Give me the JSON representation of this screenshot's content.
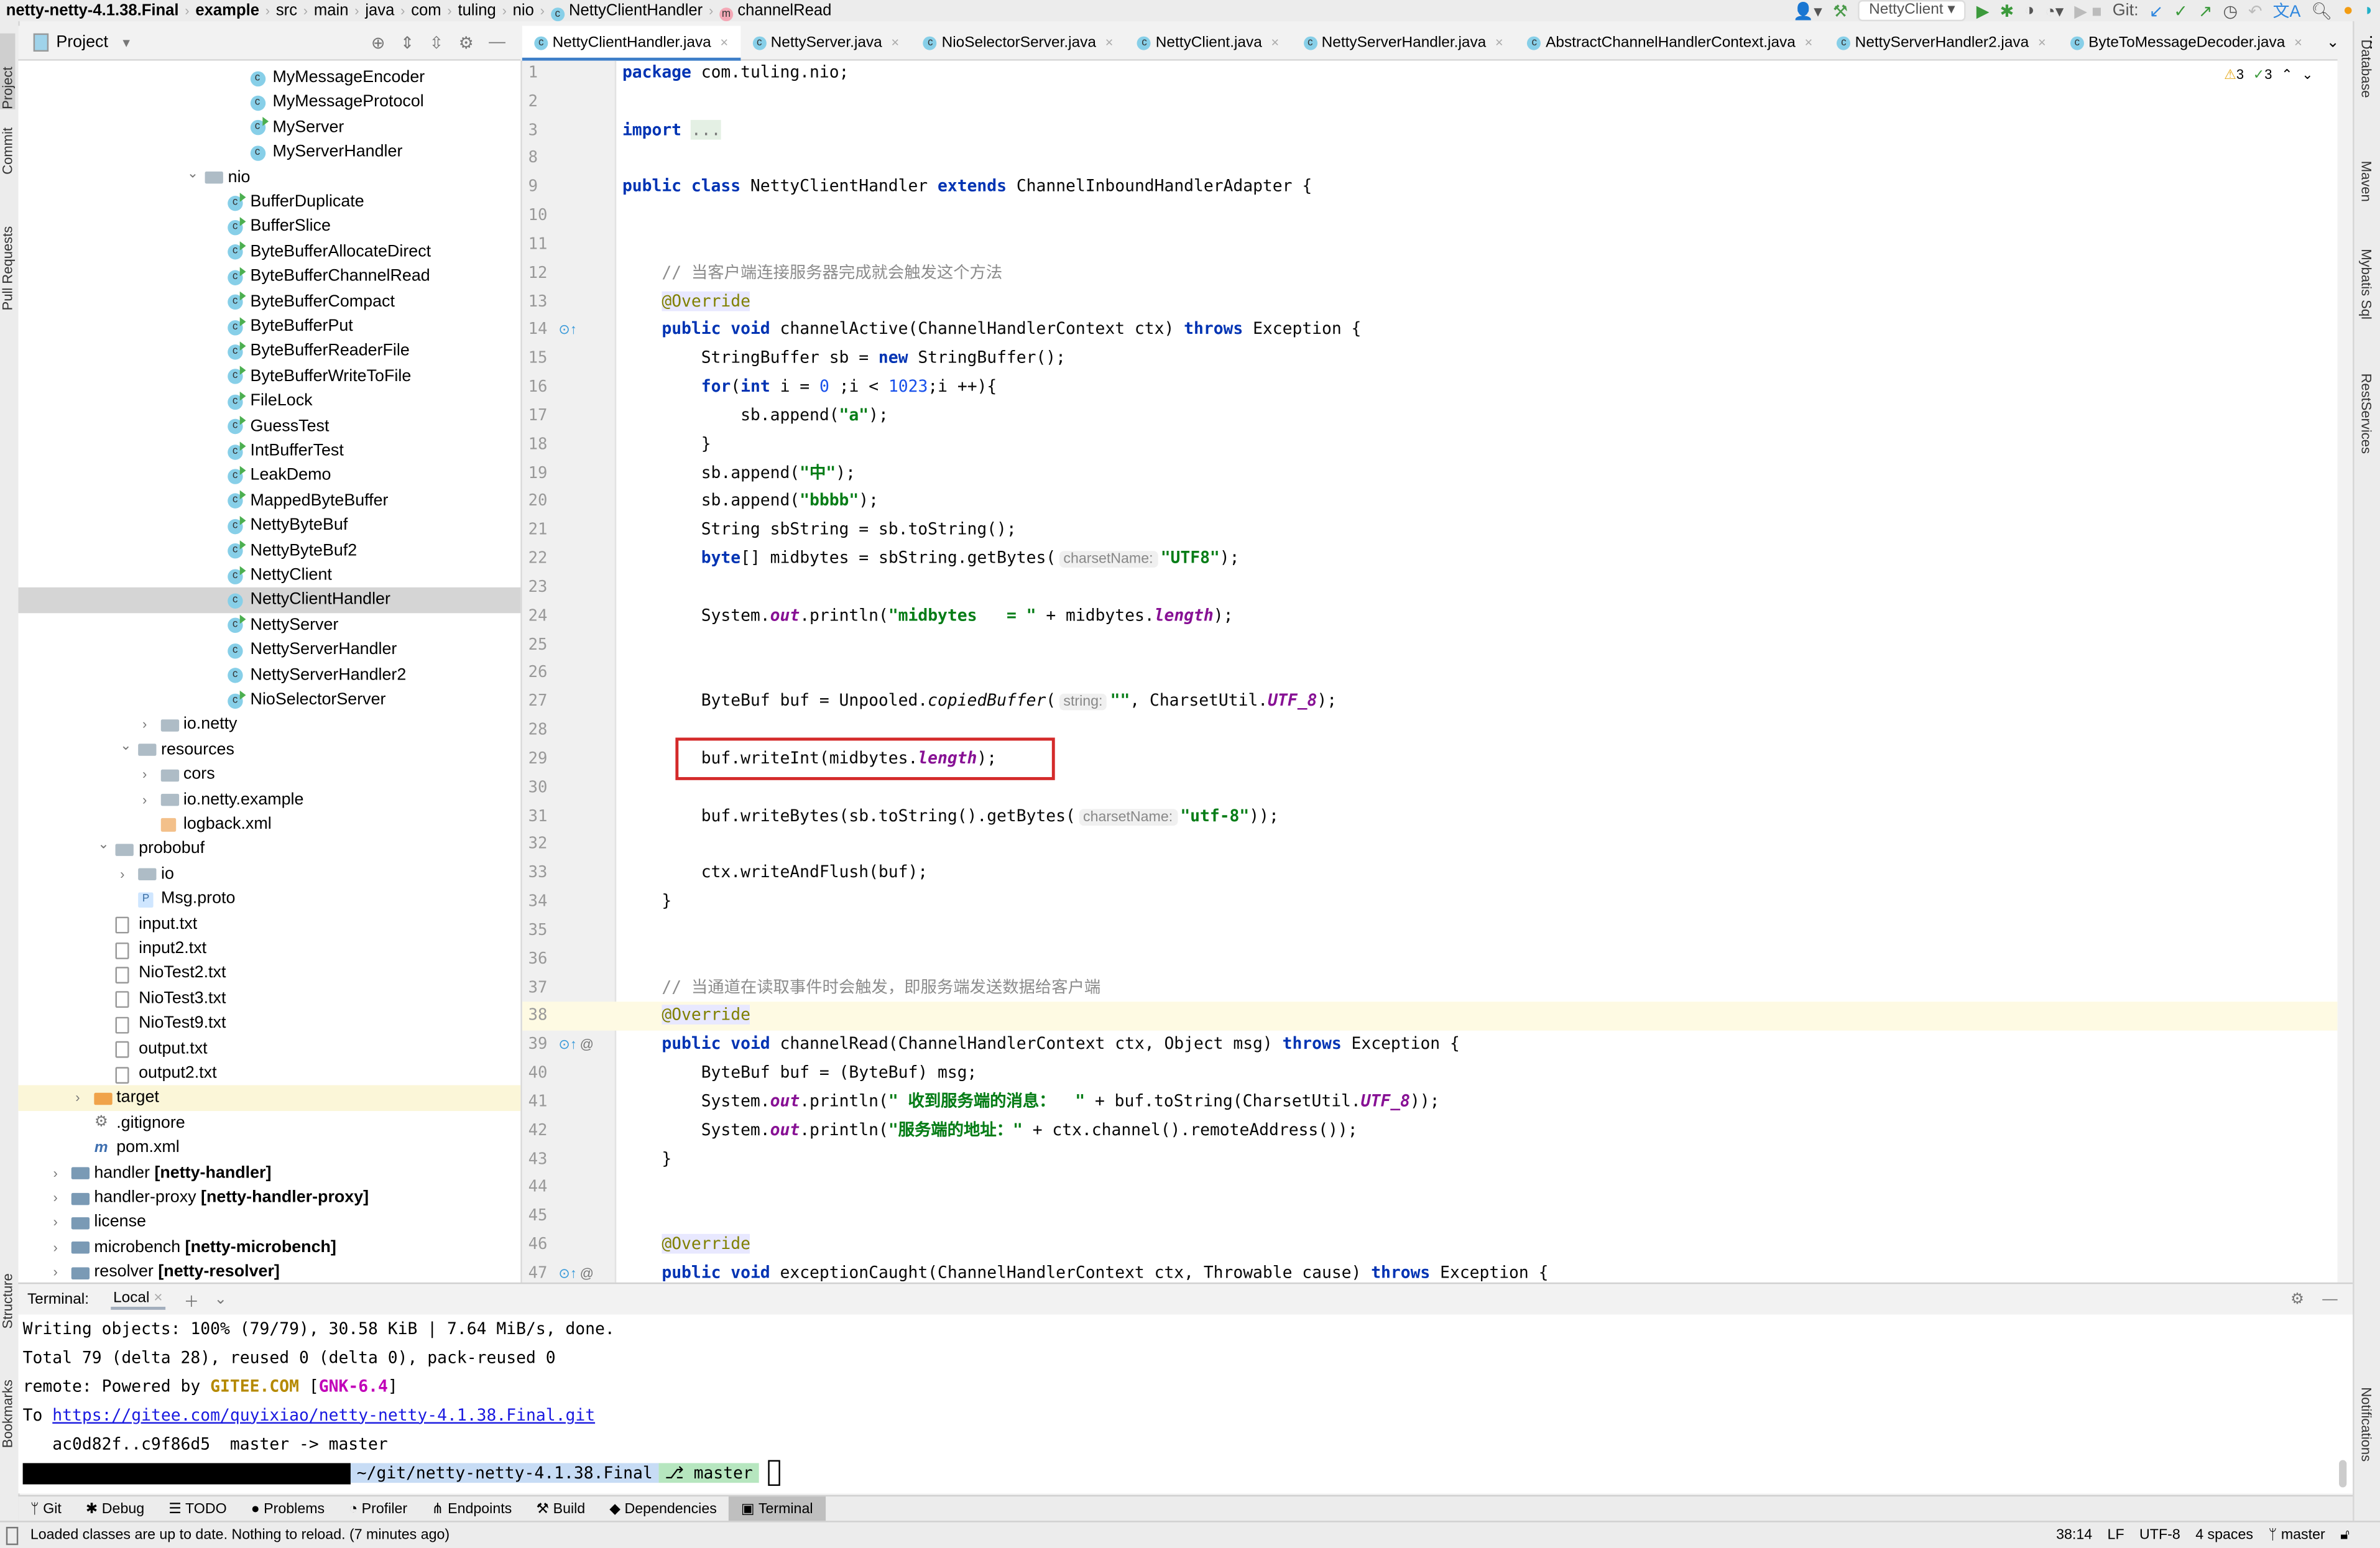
{
  "breadcrumb": [
    "netty-netty-4.1.38.Final",
    "example",
    "src",
    "main",
    "java",
    "com",
    "tuling",
    "nio",
    "NettyClientHandler",
    "channelRead"
  ],
  "toolbar": {
    "run_config": "NettyClient",
    "git_label": "Git:",
    "icons": [
      "user-icon",
      "hammer-icon",
      "run-icon",
      "debug-icon",
      "coverage-icon",
      "profile-icon",
      "stop-icon",
      "git-update-icon",
      "git-commit-icon",
      "git-push-icon",
      "history-icon",
      "rollback-icon",
      "translate-icon",
      "search-icon",
      "ide-update-icon",
      "jetbrains-logo-icon"
    ]
  },
  "left_strip": [
    "Project",
    "Commit",
    "Pull Requests",
    "Structure",
    "Bookmarks"
  ],
  "right_strip": [
    "Database",
    "Maven",
    "Mybatis Sql",
    "RestServices",
    "Notifications"
  ],
  "project_panel": {
    "title": "Project",
    "tree": [
      {
        "level": 8,
        "icon": "class",
        "label": "MyMessageEncoder"
      },
      {
        "level": 8,
        "icon": "class",
        "label": "MyMessageProtocol"
      },
      {
        "level": 8,
        "icon": "class-run",
        "label": "MyServer"
      },
      {
        "level": 8,
        "icon": "class",
        "label": "MyServerHandler"
      },
      {
        "level": 6,
        "icon": "folder",
        "label": "nio",
        "chevron": "open"
      },
      {
        "level": 7,
        "icon": "class-run",
        "label": "BufferDuplicate"
      },
      {
        "level": 7,
        "icon": "class-run",
        "label": "BufferSlice"
      },
      {
        "level": 7,
        "icon": "class-run",
        "label": "ByteBufferAllocateDirect"
      },
      {
        "level": 7,
        "icon": "class-run",
        "label": "ByteBufferChannelRead"
      },
      {
        "level": 7,
        "icon": "class-run",
        "label": "ByteBufferCompact"
      },
      {
        "level": 7,
        "icon": "class-run",
        "label": "ByteBufferPut"
      },
      {
        "level": 7,
        "icon": "class-run",
        "label": "ByteBufferReaderFile"
      },
      {
        "level": 7,
        "icon": "class-run",
        "label": "ByteBufferWriteToFile"
      },
      {
        "level": 7,
        "icon": "class-run",
        "label": "FileLock"
      },
      {
        "level": 7,
        "icon": "class-run",
        "label": "GuessTest"
      },
      {
        "level": 7,
        "icon": "class-run",
        "label": "IntBufferTest"
      },
      {
        "level": 7,
        "icon": "class-run",
        "label": "LeakDemo"
      },
      {
        "level": 7,
        "icon": "class-run",
        "label": "MappedByteBuffer"
      },
      {
        "level": 7,
        "icon": "class-run",
        "label": "NettyByteBuf"
      },
      {
        "level": 7,
        "icon": "class-run",
        "label": "NettyByteBuf2"
      },
      {
        "level": 7,
        "icon": "class-run",
        "label": "NettyClient"
      },
      {
        "level": 7,
        "icon": "class",
        "label": "NettyClientHandler",
        "selected": true
      },
      {
        "level": 7,
        "icon": "class-run",
        "label": "NettyServer"
      },
      {
        "level": 7,
        "icon": "class",
        "label": "NettyServerHandler"
      },
      {
        "level": 7,
        "icon": "class",
        "label": "NettyServerHandler2"
      },
      {
        "level": 7,
        "icon": "class-run",
        "label": "NioSelectorServer"
      },
      {
        "level": 4,
        "icon": "folder",
        "label": "io.netty",
        "chevron": "closed"
      },
      {
        "level": 3,
        "icon": "folder",
        "label": "resources",
        "chevron": "open"
      },
      {
        "level": 4,
        "icon": "folder",
        "label": "cors",
        "chevron": "closed"
      },
      {
        "level": 4,
        "icon": "folder",
        "label": "io.netty.example",
        "chevron": "closed"
      },
      {
        "level": 4,
        "icon": "xml",
        "label": "logback.xml"
      },
      {
        "level": 2,
        "icon": "folder",
        "label": "probobuf",
        "chevron": "open"
      },
      {
        "level": 3,
        "icon": "folder",
        "label": "io",
        "chevron": "closed"
      },
      {
        "level": 3,
        "icon": "proto",
        "label": "Msg.proto"
      },
      {
        "level": 2,
        "icon": "file",
        "label": "input.txt"
      },
      {
        "level": 2,
        "icon": "file",
        "label": "input2.txt"
      },
      {
        "level": 2,
        "icon": "file",
        "label": "NioTest2.txt"
      },
      {
        "level": 2,
        "icon": "file",
        "label": "NioTest3.txt"
      },
      {
        "level": 2,
        "icon": "file",
        "label": "NioTest9.txt"
      },
      {
        "level": 2,
        "icon": "file",
        "label": "output.txt"
      },
      {
        "level": 2,
        "icon": "file",
        "label": "output2.txt"
      },
      {
        "level": 1,
        "icon": "folder-orange",
        "label": "target",
        "chevron": "closed",
        "highlight": true
      },
      {
        "level": 1,
        "icon": "gitignore",
        "label": ".gitignore"
      },
      {
        "level": 1,
        "icon": "maven",
        "label": "pom.xml"
      },
      {
        "level": 0,
        "icon": "module",
        "label": "handler ",
        "bold": "[netty-handler]",
        "chevron": "closed"
      },
      {
        "level": 0,
        "icon": "module",
        "label": "handler-proxy ",
        "bold": "[netty-handler-proxy]",
        "chevron": "closed"
      },
      {
        "level": 0,
        "icon": "module",
        "label": "license",
        "chevron": "closed"
      },
      {
        "level": 0,
        "icon": "module",
        "label": "microbench ",
        "bold": "[netty-microbench]",
        "chevron": "closed"
      },
      {
        "level": 0,
        "icon": "module",
        "label": "resolver ",
        "bold": "[netty-resolver]",
        "chevron": "closed"
      }
    ]
  },
  "tabs": [
    {
      "label": "NettyClientHandler.java",
      "active": true
    },
    {
      "label": "NettyServer.java"
    },
    {
      "label": "NioSelectorServer.java"
    },
    {
      "label": "NettyClient.java"
    },
    {
      "label": "NettyServerHandler.java"
    },
    {
      "label": "AbstractChannelHandlerContext.java"
    },
    {
      "label": "NettyServerHandler2.java"
    },
    {
      "label": "ByteToMessageDecoder.java"
    }
  ],
  "editor": {
    "warnings": "3",
    "checks": "3",
    "current_line": 38,
    "gutter_markers": {
      "14": "override-icon",
      "39": "override-icon",
      "47": "override-icon"
    },
    "lines": [
      {
        "n": 1,
        "t": [
          [
            "kw",
            "package"
          ],
          [
            "p",
            " com.tuling.nio;"
          ]
        ]
      },
      {
        "n": 2,
        "t": []
      },
      {
        "n": 3,
        "t": [
          [
            "kw",
            "import"
          ],
          [
            "p",
            " "
          ],
          [
            "fold",
            "..."
          ]
        ]
      },
      {
        "n": 8,
        "t": []
      },
      {
        "n": 9,
        "t": [
          [
            "kw",
            "public class "
          ],
          [
            "p",
            "NettyClientHandler "
          ],
          [
            "kw",
            "extends "
          ],
          [
            "p",
            "ChannelInboundHandlerAdapter {"
          ]
        ]
      },
      {
        "n": 10,
        "t": []
      },
      {
        "n": 11,
        "t": []
      },
      {
        "n": 12,
        "t": [
          [
            "p",
            "    "
          ],
          [
            "cmt",
            "// 当客户端连接服务器完成就会触发这个方法"
          ]
        ]
      },
      {
        "n": 13,
        "t": [
          [
            "p",
            "    "
          ],
          [
            "ann",
            "@Override"
          ]
        ]
      },
      {
        "n": 14,
        "t": [
          [
            "p",
            "    "
          ],
          [
            "kw",
            "public void "
          ],
          [
            "p",
            "channelActive(ChannelHandlerContext ctx) "
          ],
          [
            "kw",
            "throws "
          ],
          [
            "p",
            "Exception {"
          ]
        ]
      },
      {
        "n": 15,
        "t": [
          [
            "p",
            "        StringBuffer sb = "
          ],
          [
            "kw",
            "new "
          ],
          [
            "p",
            "StringBuffer();"
          ]
        ]
      },
      {
        "n": 16,
        "t": [
          [
            "p",
            "        "
          ],
          [
            "kw",
            "for"
          ],
          [
            "p",
            "("
          ],
          [
            "kw",
            "int"
          ],
          [
            "p",
            " i = "
          ],
          [
            "num",
            "0"
          ],
          [
            "p",
            " ;i < "
          ],
          [
            "num",
            "1023"
          ],
          [
            "p",
            ";i ++){"
          ]
        ]
      },
      {
        "n": 17,
        "t": [
          [
            "p",
            "            sb.append("
          ],
          [
            "str",
            "\"a\""
          ],
          [
            "p",
            ");"
          ]
        ]
      },
      {
        "n": 18,
        "t": [
          [
            "p",
            "        }"
          ]
        ]
      },
      {
        "n": 19,
        "t": [
          [
            "p",
            "        sb.append("
          ],
          [
            "str",
            "\"中\""
          ],
          [
            "p",
            ");"
          ]
        ]
      },
      {
        "n": 20,
        "t": [
          [
            "p",
            "        sb.append("
          ],
          [
            "str",
            "\"bbbb\""
          ],
          [
            "p",
            ");"
          ]
        ]
      },
      {
        "n": 21,
        "t": [
          [
            "p",
            "        String sbString = sb.toString();"
          ]
        ]
      },
      {
        "n": 22,
        "t": [
          [
            "p",
            "        "
          ],
          [
            "kw",
            "byte"
          ],
          [
            "p",
            "[] midbytes = sbString.getBytes("
          ],
          [
            "hint",
            "charsetName:"
          ],
          [
            "str",
            "\"UTF8\""
          ],
          [
            "p",
            ");"
          ]
        ]
      },
      {
        "n": 23,
        "t": []
      },
      {
        "n": 24,
        "t": [
          [
            "p",
            "        System."
          ],
          [
            "field",
            "out"
          ],
          [
            "p",
            ".println("
          ],
          [
            "str",
            "\"midbytes   = \""
          ],
          [
            "p",
            " + midbytes."
          ],
          [
            "field",
            "length"
          ],
          [
            "p",
            ");"
          ]
        ]
      },
      {
        "n": 25,
        "t": []
      },
      {
        "n": 26,
        "t": []
      },
      {
        "n": 27,
        "t": [
          [
            "p",
            "        ByteBuf buf = Unpooled."
          ],
          [
            "ital",
            "copiedBuffer"
          ],
          [
            "p",
            "("
          ],
          [
            "hint",
            "string:"
          ],
          [
            "str",
            "\"\""
          ],
          [
            "p",
            ", CharsetUtil."
          ],
          [
            "field",
            "UTF_8"
          ],
          [
            "p",
            ");"
          ]
        ]
      },
      {
        "n": 28,
        "t": []
      },
      {
        "n": 29,
        "t": [
          [
            "p",
            "        buf.writeInt(midbytes."
          ],
          [
            "field",
            "length"
          ],
          [
            "p",
            ");"
          ]
        ]
      },
      {
        "n": 30,
        "t": []
      },
      {
        "n": 31,
        "t": [
          [
            "p",
            "        buf.writeBytes(sb.toString().getBytes("
          ],
          [
            "hint",
            "charsetName:"
          ],
          [
            "str",
            "\"utf-8\""
          ],
          [
            "p",
            "));"
          ]
        ]
      },
      {
        "n": 32,
        "t": []
      },
      {
        "n": 33,
        "t": [
          [
            "p",
            "        ctx.writeAndFlush(buf);"
          ]
        ]
      },
      {
        "n": 34,
        "t": [
          [
            "p",
            "    }"
          ]
        ]
      },
      {
        "n": 35,
        "t": []
      },
      {
        "n": 36,
        "t": []
      },
      {
        "n": 37,
        "t": [
          [
            "p",
            "    "
          ],
          [
            "cmt",
            "// 当通道在读取事件时会触发，即服务端发送数据给客户端"
          ]
        ]
      },
      {
        "n": 38,
        "t": [
          [
            "p",
            "    "
          ],
          [
            "ann",
            "@Override"
          ]
        ]
      },
      {
        "n": 39,
        "t": [
          [
            "p",
            "    "
          ],
          [
            "kw",
            "public void "
          ],
          [
            "p",
            "channelRead(ChannelHandlerContext ctx, Object msg) "
          ],
          [
            "kw",
            "throws "
          ],
          [
            "p",
            "Exception {"
          ]
        ]
      },
      {
        "n": 40,
        "t": [
          [
            "p",
            "        ByteBuf buf = (ByteBuf) msg;"
          ]
        ]
      },
      {
        "n": 41,
        "t": [
          [
            "p",
            "        System."
          ],
          [
            "field",
            "out"
          ],
          [
            "p",
            ".println("
          ],
          [
            "str",
            "\" 收到服务端的消息：  \""
          ],
          [
            "p",
            " + buf.toString(CharsetUtil."
          ],
          [
            "field",
            "UTF_8"
          ],
          [
            "p",
            "));"
          ]
        ]
      },
      {
        "n": 42,
        "t": [
          [
            "p",
            "        System."
          ],
          [
            "field",
            "out"
          ],
          [
            "p",
            ".println("
          ],
          [
            "str",
            "\"服务端的地址：\""
          ],
          [
            "p",
            " + ctx.channel().remoteAddress());"
          ]
        ]
      },
      {
        "n": 43,
        "t": [
          [
            "p",
            "    }"
          ]
        ]
      },
      {
        "n": 44,
        "t": []
      },
      {
        "n": 45,
        "t": []
      },
      {
        "n": 46,
        "t": [
          [
            "p",
            "    "
          ],
          [
            "ann",
            "@Override"
          ]
        ]
      },
      {
        "n": 47,
        "t": [
          [
            "p",
            "    "
          ],
          [
            "kw",
            "public void "
          ],
          [
            "p",
            "exceptionCaught(ChannelHandlerContext ctx, Throwable cause) "
          ],
          [
            "kw",
            "throws "
          ],
          [
            "p",
            "Exception {"
          ]
        ]
      }
    ]
  },
  "terminal": {
    "label": "Terminal:",
    "tab": "Local",
    "lines": [
      [
        [
          "p",
          "Writing objects: 100% (79/79), 30.58 KiB | 7.64 MiB/s, done."
        ]
      ],
      [
        [
          "p",
          "Total 79 (delta 28), reused 0 (delta 0), pack-reused 0"
        ]
      ],
      [
        [
          "p",
          "remote: Powered by "
        ],
        [
          "y",
          "GITEE.COM"
        ],
        [
          "p",
          " ["
        ],
        [
          "m",
          "GNK-6.4"
        ],
        [
          "p",
          "]"
        ]
      ],
      [
        [
          "p",
          "To "
        ],
        [
          "lnk",
          "https://gitee.com/quyixiao/netty-netty-4.1.38.Final.git"
        ]
      ],
      [
        [
          "p",
          "   ac0d82f..c9f86d5  master -> master"
        ]
      ]
    ],
    "prompt_path": "~/git/netty-netty-4.1.38.Final",
    "prompt_branch": "⎇ master"
  },
  "bottom_tools": [
    {
      "label": "Git",
      "icon": "git-branch-icon",
      "glyph": "ᛘ"
    },
    {
      "label": "Debug",
      "icon": "bug-icon",
      "glyph": "✱"
    },
    {
      "label": "TODO",
      "icon": "list-icon",
      "glyph": "☰"
    },
    {
      "label": "Problems",
      "icon": "problems-icon",
      "glyph": "●"
    },
    {
      "label": "Profiler",
      "icon": "profiler-icon",
      "glyph": "◔"
    },
    {
      "label": "Endpoints",
      "icon": "endpoints-icon",
      "glyph": "⋔"
    },
    {
      "label": "Build",
      "icon": "hammer-icon",
      "glyph": "⚒"
    },
    {
      "label": "Dependencies",
      "icon": "dependencies-icon",
      "glyph": "◆"
    },
    {
      "label": "Terminal",
      "icon": "terminal-icon",
      "glyph": "▣",
      "active": true
    }
  ],
  "status": {
    "message": "Loaded classes are up to date. Nothing to reload. (7 minutes ago)",
    "position": "38:14",
    "line_sep": "LF",
    "encoding": "UTF-8",
    "indent": "4 spaces",
    "branch": "master"
  }
}
